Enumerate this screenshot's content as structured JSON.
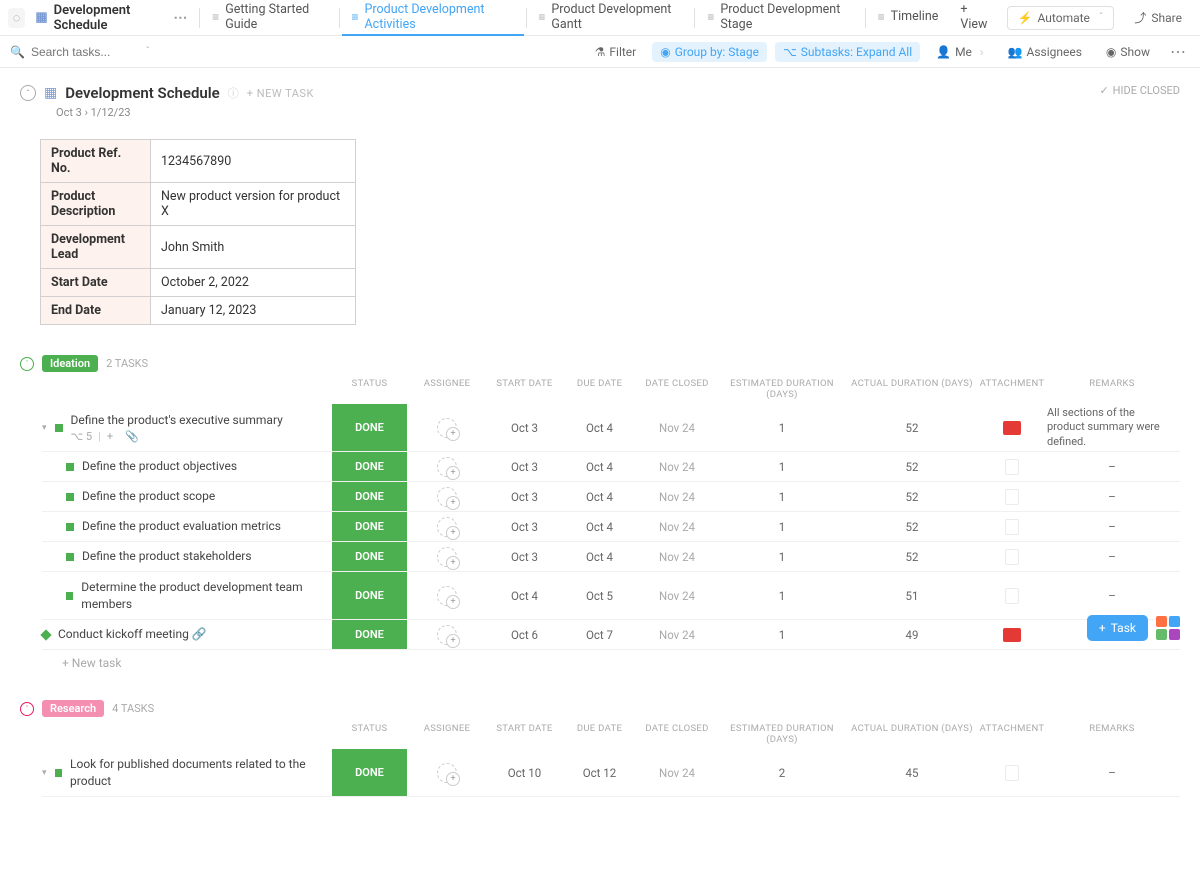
{
  "header": {
    "doc_title": "Development Schedule",
    "tabs": [
      "Getting Started Guide",
      "Product Development Activities",
      "Product Development Gantt",
      "Product Development Stage",
      "Timeline"
    ],
    "add_view": "+ View",
    "automate": "Automate",
    "share": "Share"
  },
  "toolbar": {
    "search_placeholder": "Search tasks...",
    "filter": "Filter",
    "group_by": "Group by: Stage",
    "subtasks": "Subtasks: Expand All",
    "me": "Me",
    "assignees": "Assignees",
    "show": "Show"
  },
  "page": {
    "title": "Development Schedule",
    "new_task": "+ NEW TASK",
    "date_range": "Oct 3  ›  1/12/23",
    "hide_closed": "HIDE CLOSED"
  },
  "info": [
    {
      "label": "Product Ref. No.",
      "value": "1234567890"
    },
    {
      "label": "Product Description",
      "value": "New product version for product X"
    },
    {
      "label": "Development Lead",
      "value": "John Smith"
    },
    {
      "label": "Start Date",
      "value": "October 2, 2022"
    },
    {
      "label": "End Date",
      "value": "January 12, 2023"
    }
  ],
  "cols": [
    "",
    "STATUS",
    "ASSIGNEE",
    "START DATE",
    "DUE DATE",
    "DATE CLOSED",
    "ESTIMATED DURATION (DAYS)",
    "ACTUAL DURATION (DAYS)",
    "ATTACHMENT",
    "REMARKS"
  ],
  "groups": [
    {
      "name": "Ideation",
      "count": "2 TASKS",
      "color": "green",
      "tasks": [
        {
          "name": "Define the product's executive summary",
          "status": "DONE",
          "start": "Oct 3",
          "due": "Oct 4",
          "closed": "Nov 24",
          "est": "1",
          "act": "52",
          "attach": "pdf",
          "remark": "All sections of the product summary were defined.",
          "meta": "5",
          "tall": true,
          "sub": false,
          "dia": false
        },
        {
          "name": "Define the product objectives",
          "status": "DONE",
          "start": "Oct 3",
          "due": "Oct 4",
          "closed": "Nov 24",
          "est": "1",
          "act": "52",
          "attach": "file",
          "remark": "–",
          "sub": true,
          "dia": false
        },
        {
          "name": "Define the product scope",
          "status": "DONE",
          "start": "Oct 3",
          "due": "Oct 4",
          "closed": "Nov 24",
          "est": "1",
          "act": "52",
          "attach": "file",
          "remark": "–",
          "sub": true,
          "dia": false
        },
        {
          "name": "Define the product evaluation metrics",
          "status": "DONE",
          "start": "Oct 3",
          "due": "Oct 4",
          "closed": "Nov 24",
          "est": "1",
          "act": "52",
          "attach": "file",
          "remark": "–",
          "sub": true,
          "dia": false
        },
        {
          "name": "Define the product stakeholders",
          "status": "DONE",
          "start": "Oct 3",
          "due": "Oct 4",
          "closed": "Nov 24",
          "est": "1",
          "act": "52",
          "attach": "file",
          "remark": "–",
          "sub": true,
          "dia": false
        },
        {
          "name": "Determine the product development team members",
          "status": "DONE",
          "start": "Oct 4",
          "due": "Oct 5",
          "closed": "Nov 24",
          "est": "1",
          "act": "51",
          "attach": "file",
          "remark": "–",
          "sub": true,
          "tall": true,
          "dia": false
        },
        {
          "name": "Conduct kickoff meeting",
          "status": "DONE",
          "start": "Oct 6",
          "due": "Oct 7",
          "closed": "Nov 24",
          "est": "1",
          "act": "49",
          "attach": "pdf",
          "remark": "–",
          "sub": false,
          "dia": true,
          "link": true
        }
      ],
      "new_task": "+ New task"
    },
    {
      "name": "Research",
      "count": "4 TASKS",
      "color": "pink",
      "tasks": [
        {
          "name": "Look for published documents related to the product",
          "status": "DONE",
          "start": "Oct 10",
          "due": "Oct 12",
          "closed": "Nov 24",
          "est": "2",
          "act": "45",
          "attach": "file",
          "remark": "–",
          "sub": false,
          "tall": true,
          "dia": false
        }
      ]
    }
  ],
  "fab": {
    "task": "Task"
  }
}
